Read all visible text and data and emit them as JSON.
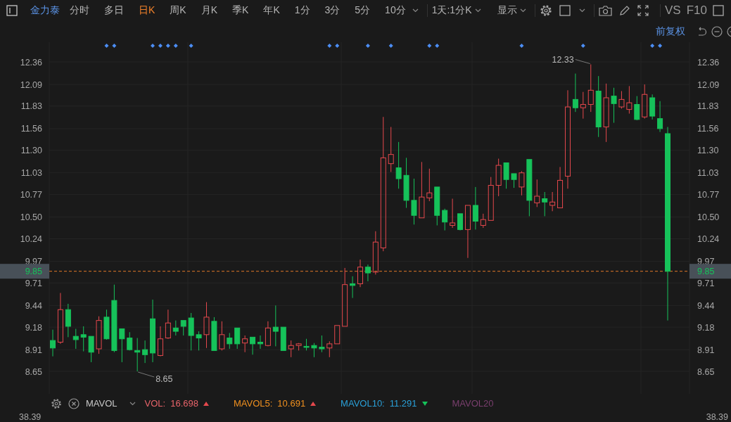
{
  "toolbar": {
    "stock_name": "金力泰",
    "periods": [
      {
        "label": "分时",
        "selected": false
      },
      {
        "label": "多日",
        "selected": false
      },
      {
        "label": "日K",
        "selected": true
      },
      {
        "label": "周K",
        "selected": false
      },
      {
        "label": "月K",
        "selected": false
      },
      {
        "label": "季K",
        "selected": false
      },
      {
        "label": "年K",
        "selected": false
      },
      {
        "label": "1分",
        "selected": false
      },
      {
        "label": "3分",
        "selected": false
      },
      {
        "label": "5分",
        "selected": false
      },
      {
        "label": "10分",
        "selected": false
      }
    ],
    "range_dropdown": "1天:1分K",
    "display_dropdown": "显示",
    "vs_button": "VS",
    "f10_button": "F10"
  },
  "sub_toolbar": {
    "adjust_mode": "前复权"
  },
  "chart": {
    "chart_data": {
      "type": "candlestick",
      "ylim": [
        8.65,
        12.36
      ],
      "grid": true,
      "yticks": [
        {
          "value": 12.36,
          "label": "12.36"
        },
        {
          "value": 12.09,
          "label": "12.09"
        },
        {
          "value": 11.83,
          "label": "11.83"
        },
        {
          "value": 11.56,
          "label": "11.56"
        },
        {
          "value": 11.3,
          "label": "11.30"
        },
        {
          "value": 11.03,
          "label": "11.03"
        },
        {
          "value": 10.77,
          "label": "10.77"
        },
        {
          "value": 10.5,
          "label": "10.50"
        },
        {
          "value": 10.24,
          "label": "10.24"
        },
        {
          "value": 9.97,
          "label": "9.97"
        },
        {
          "value": 9.71,
          "label": "9.71"
        },
        {
          "value": 9.44,
          "label": "9.44"
        },
        {
          "value": 9.18,
          "label": "9.18"
        },
        {
          "value": 8.91,
          "label": "8.91"
        },
        {
          "value": 8.65,
          "label": "8.65"
        }
      ],
      "ohlc": [
        [
          9.02,
          9.15,
          8.83,
          8.93
        ],
        [
          9.0,
          9.59,
          8.98,
          9.39
        ],
        [
          9.39,
          9.46,
          9.06,
          9.19
        ],
        [
          9.07,
          9.16,
          8.92,
          9.03
        ],
        [
          9.09,
          9.19,
          8.89,
          9.06
        ],
        [
          9.07,
          9.07,
          8.76,
          8.88
        ],
        [
          8.92,
          9.31,
          8.86,
          9.26
        ],
        [
          9.3,
          9.39,
          9.03,
          9.04
        ],
        [
          9.5,
          9.69,
          8.88,
          8.9
        ],
        [
          9.16,
          9.16,
          8.76,
          9.04
        ],
        [
          9.05,
          9.12,
          8.9,
          8.91
        ],
        [
          8.9,
          9.05,
          8.65,
          8.88
        ],
        [
          8.91,
          9.02,
          8.75,
          8.85
        ],
        [
          9.28,
          9.51,
          8.76,
          8.87
        ],
        [
          8.84,
          9.19,
          8.83,
          9.04
        ],
        [
          9.05,
          9.39,
          9.04,
          9.23
        ],
        [
          9.17,
          9.26,
          9.08,
          9.13
        ],
        [
          9.26,
          9.26,
          9.08,
          9.19
        ],
        [
          9.29,
          9.35,
          8.9,
          9.08
        ],
        [
          9.09,
          9.13,
          8.9,
          9.05
        ],
        [
          9.09,
          9.48,
          8.93,
          9.3
        ],
        [
          9.25,
          9.3,
          8.9,
          8.9
        ],
        [
          8.92,
          9.25,
          8.9,
          9.09
        ],
        [
          9.05,
          9.11,
          8.92,
          8.98
        ],
        [
          9.17,
          9.17,
          8.92,
          8.98
        ],
        [
          8.99,
          9.08,
          8.88,
          9.04
        ],
        [
          9.06,
          9.06,
          8.85,
          8.98
        ],
        [
          9.0,
          9.08,
          8.92,
          8.98
        ],
        [
          8.96,
          9.25,
          8.95,
          9.17
        ],
        [
          9.18,
          9.44,
          8.95,
          9.13
        ],
        [
          9.18,
          9.18,
          8.9,
          8.9
        ],
        [
          8.92,
          9.02,
          8.82,
          8.96
        ],
        [
          8.96,
          8.99,
          8.9,
          8.98
        ],
        [
          8.95,
          9.04,
          8.9,
          8.94
        ],
        [
          8.96,
          8.99,
          8.82,
          8.93
        ],
        [
          8.94,
          9.08,
          8.88,
          8.92
        ],
        [
          8.93,
          9.01,
          8.82,
          8.98
        ],
        [
          8.98,
          9.2,
          8.98,
          9.2
        ],
        [
          9.19,
          9.89,
          9.19,
          9.69
        ],
        [
          9.7,
          9.79,
          9.53,
          9.68
        ],
        [
          9.7,
          9.99,
          9.66,
          9.9
        ],
        [
          9.9,
          9.93,
          9.73,
          9.83
        ],
        [
          9.84,
          10.33,
          9.81,
          10.2
        ],
        [
          10.13,
          11.7,
          10.09,
          11.21
        ],
        [
          11.14,
          11.58,
          11.04,
          11.25
        ],
        [
          11.09,
          11.4,
          10.84,
          10.96
        ],
        [
          11.0,
          11.21,
          10.61,
          10.7
        ],
        [
          10.7,
          10.96,
          10.41,
          10.52
        ],
        [
          10.49,
          11.16,
          10.49,
          10.74
        ],
        [
          10.73,
          11.08,
          10.69,
          10.79
        ],
        [
          10.86,
          10.86,
          10.4,
          10.52
        ],
        [
          10.58,
          10.6,
          10.34,
          10.44
        ],
        [
          10.4,
          10.72,
          10.37,
          10.43
        ],
        [
          10.54,
          10.54,
          10.34,
          10.35
        ],
        [
          10.35,
          10.64,
          10.01,
          10.64
        ],
        [
          10.64,
          10.86,
          10.35,
          10.45
        ],
        [
          10.4,
          10.54,
          10.37,
          10.47
        ],
        [
          10.46,
          10.98,
          10.46,
          10.88
        ],
        [
          10.88,
          11.2,
          10.75,
          11.12
        ],
        [
          11.15,
          11.15,
          10.84,
          10.95
        ],
        [
          11.02,
          11.02,
          10.85,
          10.95
        ],
        [
          10.86,
          11.05,
          10.76,
          11.03
        ],
        [
          11.19,
          11.19,
          10.51,
          10.7
        ],
        [
          10.67,
          10.95,
          10.62,
          10.75
        ],
        [
          10.72,
          10.8,
          10.51,
          10.68
        ],
        [
          10.64,
          10.8,
          10.57,
          10.68
        ],
        [
          10.61,
          11.1,
          10.61,
          10.94
        ],
        [
          10.99,
          12.02,
          10.84,
          11.82
        ],
        [
          11.91,
          12.22,
          11.76,
          11.81
        ],
        [
          11.81,
          12.0,
          11.68,
          11.85
        ],
        [
          11.85,
          12.33,
          11.76,
          12.02
        ],
        [
          12.01,
          12.19,
          11.46,
          11.58
        ],
        [
          11.58,
          12.1,
          11.4,
          11.93
        ],
        [
          11.95,
          12.05,
          11.63,
          11.86
        ],
        [
          11.82,
          12.01,
          11.8,
          11.91
        ],
        [
          11.79,
          12.07,
          11.74,
          11.87
        ],
        [
          11.85,
          11.95,
          11.66,
          11.67
        ],
        [
          11.7,
          12.09,
          11.68,
          11.97
        ],
        [
          11.93,
          11.97,
          11.67,
          11.71
        ],
        [
          11.68,
          11.89,
          11.52,
          11.56
        ],
        [
          11.5,
          11.58,
          9.26,
          9.85
        ]
      ],
      "annotations": [
        "12.33",
        "8.65"
      ],
      "ref_lines": [
        {
          "axis": "y",
          "value": 9.85,
          "label": "9.85",
          "color": "#e0782a"
        }
      ]
    },
    "candle_markers": [
      false,
      false,
      false,
      false,
      false,
      false,
      false,
      true,
      true,
      false,
      false,
      false,
      false,
      true,
      true,
      true,
      true,
      false,
      true,
      false,
      false,
      false,
      false,
      false,
      false,
      false,
      false,
      false,
      false,
      false,
      false,
      false,
      false,
      false,
      false,
      false,
      true,
      true,
      false,
      false,
      false,
      true,
      false,
      false,
      true,
      false,
      false,
      false,
      false,
      true,
      true,
      false,
      false,
      false,
      false,
      false,
      false,
      false,
      false,
      false,
      false,
      true,
      false,
      false,
      false,
      false,
      false,
      false,
      false,
      true,
      false,
      false,
      false,
      false,
      false,
      false,
      false,
      false,
      true,
      true,
      false
    ],
    "right_axis_labels": [
      "12.36",
      "12.09",
      "11.83",
      "11.56",
      "11.30",
      "11.03",
      "10.77",
      "10.50",
      "10.24",
      "9.97",
      "9.71",
      "9.44",
      "9.18",
      "8.91",
      "8.65"
    ],
    "current_price": {
      "right_label": "9.85"
    }
  },
  "indicator_bar": {
    "name": "MAVOL",
    "items": [
      {
        "label": "VOL:",
        "value": "16.698",
        "rising": true,
        "color": "#e8646a"
      },
      {
        "label": "MAVOL5:",
        "value": "10.691",
        "rising": true,
        "color": "#f0901f"
      },
      {
        "label": "MAVOL10:",
        "value": "11.291",
        "rising": false,
        "color": "#2aa0d8"
      },
      {
        "label": "MAVOL20",
        "color": "#7a3f6e"
      }
    ]
  },
  "volume_axis": {
    "left_label": "38.39",
    "right_label": "38.39"
  }
}
